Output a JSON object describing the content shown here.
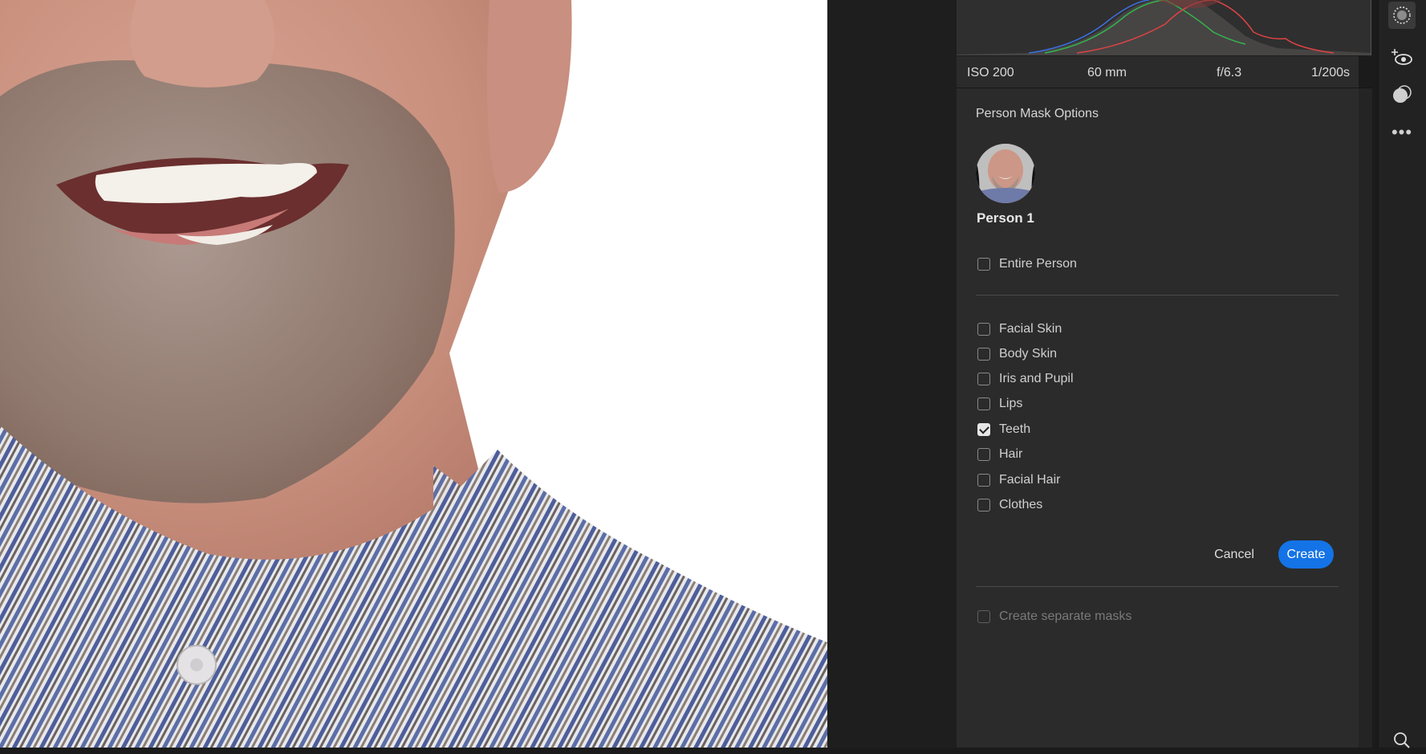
{
  "exif": {
    "iso": "ISO 200",
    "focal_length": "60 mm",
    "aperture": "f/6.3",
    "shutter": "1/200s"
  },
  "person_mask": {
    "title": "Person Mask Options",
    "person_name": "Person 1",
    "entire_person": {
      "label": "Entire Person",
      "checked": false
    },
    "parts": [
      {
        "label": "Facial Skin",
        "checked": false
      },
      {
        "label": "Body Skin",
        "checked": false
      },
      {
        "label": "Iris and Pupil",
        "checked": false
      },
      {
        "label": "Lips",
        "checked": false
      },
      {
        "label": "Teeth",
        "checked": true
      },
      {
        "label": "Hair",
        "checked": false
      },
      {
        "label": "Facial Hair",
        "checked": false
      },
      {
        "label": "Clothes",
        "checked": false
      }
    ],
    "cancel_label": "Cancel",
    "create_label": "Create",
    "separate_masks": {
      "label": "Create separate masks",
      "checked": false,
      "disabled": true
    }
  },
  "tools": [
    "mask-brush-icon",
    "add-eye-icon",
    "color-mix-icon",
    "more-icon",
    "zoom-icon"
  ],
  "colors": {
    "accent": "#1473e6",
    "panel_bg": "#2b2b2b"
  }
}
